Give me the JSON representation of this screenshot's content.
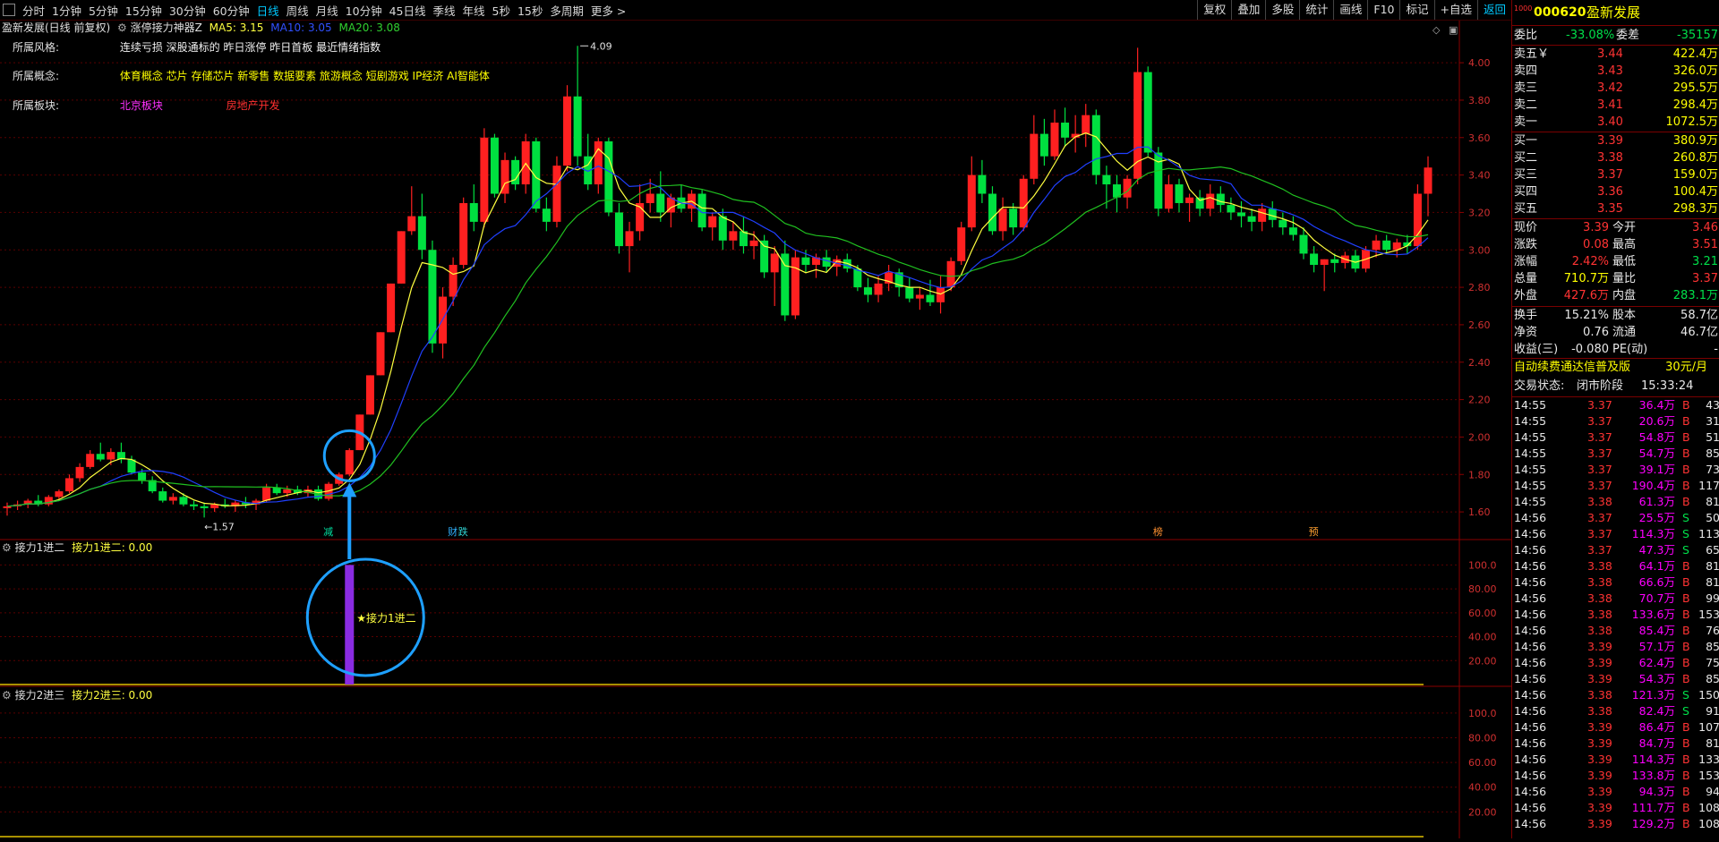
{
  "toolbar": {
    "timeframes": [
      "分时",
      "1分钟",
      "5分钟",
      "15分钟",
      "30分钟",
      "60分钟",
      "日线",
      "周线",
      "月线",
      "10分钟",
      "45日线",
      "季线",
      "年线",
      "5秒",
      "15秒",
      "多周期",
      "更多 >"
    ],
    "active": "日线",
    "right_buttons": [
      "复权",
      "叠加",
      "多股",
      "统计",
      "画线",
      "F10",
      "标记",
      "+自选",
      "返回"
    ]
  },
  "chart_header": {
    "title": "盈新发展(日线 前复权)",
    "indicator": "涨停接力神器Z",
    "ma5": "MA5: 3.15",
    "ma10": "MA10: 3.05",
    "ma20": "MA20: 3.08"
  },
  "info": {
    "style_label": "所属风格:",
    "style_value": "连续亏损 深股通标的 昨日涨停 昨日首板 最近情绪指数",
    "concept_label": "所属概念:",
    "concept_value": "体育概念 芯片 存储芯片 新零售 数据要素 旅游概念 短剧游戏 IP经济 AI智能体",
    "sector_label": "所属板块:",
    "sector_value1": "北京板块",
    "sector_value2": "房地产开发"
  },
  "annotations": {
    "high": "4.09",
    "low": "←1.57",
    "event_jian": "减",
    "event_cai": "财",
    "event_die": "跌",
    "event_bang": "榜",
    "event_yu": "预",
    "event_zhang": "涨",
    "relay_marker": "★接力1进二"
  },
  "price_axis": [
    "4.00",
    "3.80",
    "3.60",
    "3.40",
    "3.20",
    "3.00",
    "2.80",
    "2.60",
    "2.40",
    "2.20",
    "2.00",
    "1.80",
    "1.60"
  ],
  "sub1": {
    "name": "接力1进二",
    "label": "接力1进二: 0.00",
    "axis": [
      "100.0",
      "80.00",
      "60.00",
      "40.00",
      "20.00"
    ]
  },
  "sub2": {
    "name": "接力2进三",
    "label": "接力2进三: 0.00",
    "axis": [
      "100.0",
      "80.00",
      "60.00",
      "40.00",
      "20.00"
    ]
  },
  "colors": {
    "up": "#ff2020",
    "down": "#00e040",
    "ma5": "#ffff40",
    "ma10": "#2040ff",
    "ma20": "#20c020",
    "relay": "#8a2be2",
    "circle": "#1ea0ff"
  },
  "chart_data": {
    "type": "candlestick",
    "ylim": [
      1.5,
      4.12
    ],
    "candles": [
      [
        1.62,
        1.65,
        1.58,
        1.63
      ],
      [
        1.63,
        1.66,
        1.61,
        1.64
      ],
      [
        1.64,
        1.67,
        1.62,
        1.66
      ],
      [
        1.66,
        1.69,
        1.63,
        1.64
      ],
      [
        1.64,
        1.69,
        1.63,
        1.68
      ],
      [
        1.68,
        1.72,
        1.66,
        1.71
      ],
      [
        1.71,
        1.8,
        1.7,
        1.78
      ],
      [
        1.78,
        1.86,
        1.76,
        1.84
      ],
      [
        1.84,
        1.93,
        1.83,
        1.91
      ],
      [
        1.91,
        1.97,
        1.87,
        1.88
      ],
      [
        1.88,
        1.94,
        1.85,
        1.92
      ],
      [
        1.92,
        1.97,
        1.86,
        1.88
      ],
      [
        1.88,
        1.9,
        1.8,
        1.81
      ],
      [
        1.81,
        1.83,
        1.75,
        1.77
      ],
      [
        1.77,
        1.79,
        1.7,
        1.71
      ],
      [
        1.71,
        1.73,
        1.65,
        1.66
      ],
      [
        1.66,
        1.7,
        1.64,
        1.68
      ],
      [
        1.68,
        1.7,
        1.63,
        1.64
      ],
      [
        1.64,
        1.66,
        1.61,
        1.63
      ],
      [
        1.63,
        1.65,
        1.57,
        1.62
      ],
      [
        1.62,
        1.65,
        1.6,
        1.64
      ],
      [
        1.64,
        1.67,
        1.62,
        1.63
      ],
      [
        1.63,
        1.66,
        1.6,
        1.65
      ],
      [
        1.65,
        1.68,
        1.62,
        1.64
      ],
      [
        1.64,
        1.67,
        1.61,
        1.66
      ],
      [
        1.66,
        1.75,
        1.65,
        1.73
      ],
      [
        1.73,
        1.75,
        1.69,
        1.7
      ],
      [
        1.7,
        1.74,
        1.68,
        1.72
      ],
      [
        1.72,
        1.74,
        1.69,
        1.7
      ],
      [
        1.7,
        1.74,
        1.68,
        1.72
      ],
      [
        1.72,
        1.74,
        1.66,
        1.67
      ],
      [
        1.67,
        1.76,
        1.66,
        1.75
      ],
      [
        1.75,
        1.81,
        1.74,
        1.8
      ],
      [
        1.8,
        1.94,
        1.79,
        1.93
      ],
      [
        1.93,
        2.12,
        1.93,
        2.12
      ],
      [
        2.12,
        2.33,
        2.12,
        2.33
      ],
      [
        2.33,
        2.56,
        2.33,
        2.56
      ],
      [
        2.56,
        2.82,
        2.56,
        2.82
      ],
      [
        2.82,
        3.1,
        2.82,
        3.1
      ],
      [
        3.1,
        3.34,
        3.08,
        3.18
      ],
      [
        3.18,
        3.3,
        2.95,
        3.0
      ],
      [
        3.0,
        3.05,
        2.45,
        2.5
      ],
      [
        2.5,
        2.8,
        2.42,
        2.75
      ],
      [
        2.75,
        2.96,
        2.7,
        2.92
      ],
      [
        2.92,
        3.28,
        2.9,
        3.25
      ],
      [
        3.25,
        3.35,
        3.1,
        3.15
      ],
      [
        3.15,
        3.65,
        3.12,
        3.6
      ],
      [
        3.6,
        3.62,
        3.28,
        3.3
      ],
      [
        3.3,
        3.52,
        3.25,
        3.48
      ],
      [
        3.48,
        3.5,
        3.32,
        3.35
      ],
      [
        3.35,
        3.62,
        3.3,
        3.58
      ],
      [
        3.58,
        3.6,
        3.2,
        3.22
      ],
      [
        3.22,
        3.28,
        3.1,
        3.15
      ],
      [
        3.15,
        3.5,
        3.12,
        3.45
      ],
      [
        3.45,
        3.88,
        3.42,
        3.82
      ],
      [
        3.82,
        4.09,
        3.45,
        3.5
      ],
      [
        3.5,
        3.62,
        3.32,
        3.35
      ],
      [
        3.35,
        3.6,
        3.3,
        3.58
      ],
      [
        3.58,
        3.6,
        3.18,
        3.2
      ],
      [
        3.2,
        3.25,
        2.98,
        3.02
      ],
      [
        3.02,
        3.15,
        2.88,
        3.1
      ],
      [
        3.1,
        3.35,
        3.05,
        3.25
      ],
      [
        3.25,
        3.38,
        3.2,
        3.3
      ],
      [
        3.3,
        3.42,
        3.15,
        3.2
      ],
      [
        3.2,
        3.3,
        3.12,
        3.28
      ],
      [
        3.28,
        3.35,
        3.2,
        3.22
      ],
      [
        3.22,
        3.32,
        3.15,
        3.3
      ],
      [
        3.3,
        3.32,
        3.1,
        3.12
      ],
      [
        3.12,
        3.2,
        3.05,
        3.18
      ],
      [
        3.18,
        3.22,
        3.0,
        3.05
      ],
      [
        3.05,
        3.15,
        3.0,
        3.1
      ],
      [
        3.1,
        3.18,
        2.98,
        3.02
      ],
      [
        3.02,
        3.1,
        2.95,
        3.05
      ],
      [
        3.05,
        3.08,
        2.85,
        2.88
      ],
      [
        2.88,
        3.02,
        2.7,
        2.98
      ],
      [
        2.98,
        3.05,
        2.62,
        2.65
      ],
      [
        2.65,
        3.0,
        2.63,
        2.96
      ],
      [
        2.96,
        3.0,
        2.88,
        2.92
      ],
      [
        2.92,
        2.98,
        2.85,
        2.96
      ],
      [
        2.96,
        3.0,
        2.88,
        2.91
      ],
      [
        2.91,
        2.97,
        2.86,
        2.95
      ],
      [
        2.95,
        2.98,
        2.88,
        2.9
      ],
      [
        2.9,
        2.92,
        2.78,
        2.8
      ],
      [
        2.8,
        2.85,
        2.72,
        2.76
      ],
      [
        2.76,
        2.86,
        2.72,
        2.82
      ],
      [
        2.82,
        2.92,
        2.78,
        2.88
      ],
      [
        2.88,
        2.9,
        2.75,
        2.8
      ],
      [
        2.8,
        2.85,
        2.72,
        2.74
      ],
      [
        2.74,
        2.8,
        2.68,
        2.76
      ],
      [
        2.76,
        2.84,
        2.7,
        2.72
      ],
      [
        2.72,
        2.86,
        2.66,
        2.8
      ],
      [
        2.8,
        2.96,
        2.78,
        2.94
      ],
      [
        2.94,
        3.15,
        2.92,
        3.12
      ],
      [
        3.12,
        3.5,
        3.1,
        3.4
      ],
      [
        3.4,
        3.48,
        3.25,
        3.3
      ],
      [
        3.3,
        3.34,
        3.08,
        3.1
      ],
      [
        3.1,
        3.28,
        3.05,
        3.22
      ],
      [
        3.22,
        3.25,
        3.08,
        3.12
      ],
      [
        3.12,
        3.4,
        3.1,
        3.38
      ],
      [
        3.38,
        3.72,
        3.35,
        3.62
      ],
      [
        3.62,
        3.7,
        3.45,
        3.5
      ],
      [
        3.5,
        3.75,
        3.48,
        3.68
      ],
      [
        3.68,
        3.76,
        3.55,
        3.6
      ],
      [
        3.6,
        3.72,
        3.52,
        3.62
      ],
      [
        3.62,
        3.78,
        3.55,
        3.72
      ],
      [
        3.72,
        3.75,
        3.35,
        3.4
      ],
      [
        3.4,
        3.45,
        3.22,
        3.35
      ],
      [
        3.35,
        3.4,
        3.2,
        3.28
      ],
      [
        3.28,
        3.4,
        3.22,
        3.38
      ],
      [
        3.38,
        4.08,
        3.35,
        3.95
      ],
      [
        3.95,
        3.98,
        3.5,
        3.52
      ],
      [
        3.52,
        3.55,
        3.18,
        3.22
      ],
      [
        3.22,
        3.4,
        3.2,
        3.35
      ],
      [
        3.35,
        3.38,
        3.2,
        3.25
      ],
      [
        3.25,
        3.3,
        3.15,
        3.28
      ],
      [
        3.28,
        3.32,
        3.18,
        3.22
      ],
      [
        3.22,
        3.35,
        3.18,
        3.3
      ],
      [
        3.3,
        3.34,
        3.2,
        3.24
      ],
      [
        3.24,
        3.28,
        3.16,
        3.2
      ],
      [
        3.2,
        3.26,
        3.12,
        3.18
      ],
      [
        3.18,
        3.22,
        3.1,
        3.15
      ],
      [
        3.15,
        3.25,
        3.1,
        3.22
      ],
      [
        3.22,
        3.26,
        3.12,
        3.16
      ],
      [
        3.16,
        3.2,
        3.08,
        3.12
      ],
      [
        3.12,
        3.18,
        3.05,
        3.08
      ],
      [
        3.08,
        3.12,
        2.95,
        2.98
      ],
      [
        2.98,
        3.02,
        2.88,
        2.92
      ],
      [
        2.92,
        2.95,
        2.78,
        2.95
      ],
      [
        2.95,
        2.98,
        2.88,
        2.93
      ],
      [
        2.93,
        2.99,
        2.9,
        2.97
      ],
      [
        2.97,
        3.0,
        2.88,
        2.9
      ],
      [
        2.9,
        3.02,
        2.88,
        3.0
      ],
      [
        3.0,
        3.08,
        2.96,
        3.05
      ],
      [
        3.05,
        3.08,
        2.98,
        3.0
      ],
      [
        3.0,
        3.06,
        2.96,
        3.04
      ],
      [
        3.04,
        3.08,
        2.98,
        3.02
      ],
      [
        3.02,
        3.35,
        3.0,
        3.3
      ],
      [
        3.3,
        3.5,
        3.18,
        3.44
      ]
    ],
    "relay_bar_index": 33,
    "relay_value": 100
  },
  "quote": {
    "code": "000620",
    "name": "盈新发展",
    "weibi_label": "委比",
    "weibi": "-33.08%",
    "weicha_label": "委差",
    "weicha": "-35157",
    "sells": [
      {
        "label": "卖五￥",
        "price": "3.44",
        "vol": "422.4万"
      },
      {
        "label": "卖四",
        "price": "3.43",
        "vol": "326.0万"
      },
      {
        "label": "卖三",
        "price": "3.42",
        "vol": "295.5万"
      },
      {
        "label": "卖二",
        "price": "3.41",
        "vol": "298.4万"
      },
      {
        "label": "卖一",
        "price": "3.40",
        "vol": "1072.5万"
      }
    ],
    "buys": [
      {
        "label": "买一",
        "price": "3.39",
        "vol": "380.9万"
      },
      {
        "label": "买二",
        "price": "3.38",
        "vol": "260.8万"
      },
      {
        "label": "买三",
        "price": "3.37",
        "vol": "159.0万"
      },
      {
        "label": "买四",
        "price": "3.36",
        "vol": "100.4万"
      },
      {
        "label": "买五",
        "price": "3.35",
        "vol": "298.3万"
      }
    ],
    "stats": [
      {
        "l1": "现价",
        "v1": "3.39",
        "c1": "red",
        "l2": "今开",
        "v2": "3.46",
        "c2": "red"
      },
      {
        "l1": "涨跌",
        "v1": "0.08",
        "c1": "red",
        "l2": "最高",
        "v2": "3.51",
        "c2": "red"
      },
      {
        "l1": "涨幅",
        "v1": "2.42%",
        "c1": "red",
        "l2": "最低",
        "v2": "3.21",
        "c2": "green"
      },
      {
        "l1": "总量",
        "v1": "710.7万",
        "c1": "yellow",
        "l2": "量比",
        "v2": "3.37",
        "c2": "red"
      },
      {
        "l1": "外盘",
        "v1": "427.6万",
        "c1": "red",
        "l2": "内盘",
        "v2": "283.1万",
        "c2": "green"
      }
    ],
    "stats2": [
      {
        "l1": "换手",
        "v1": "15.21%",
        "l2": "股本",
        "v2": "58.7亿"
      },
      {
        "l1": "净资",
        "v1": "0.76",
        "l2": "流通",
        "v2": "46.7亿"
      },
      {
        "l1": "收益(三)",
        "v1": "-0.080",
        "l2": "PE(动)",
        "v2": "-"
      }
    ],
    "ad_text": "自动续费通达信普及版",
    "ad_price": "30元/月",
    "trade_status_label": "交易状态:",
    "trade_status": "闭市阶段",
    "trade_time": "15:33:24",
    "ticks": [
      [
        "14:55",
        "3.37",
        "36.4万",
        "B",
        "43"
      ],
      [
        "14:55",
        "3.37",
        "20.6万",
        "B",
        "31"
      ],
      [
        "14:55",
        "3.37",
        "54.8万",
        "B",
        "51"
      ],
      [
        "14:55",
        "3.37",
        "54.7万",
        "B",
        "85"
      ],
      [
        "14:55",
        "3.37",
        "39.1万",
        "B",
        "73"
      ],
      [
        "14:55",
        "3.37",
        "190.4万",
        "B",
        "117"
      ],
      [
        "14:55",
        "3.38",
        "61.3万",
        "B",
        "81"
      ],
      [
        "14:56",
        "3.37",
        "25.5万",
        "S",
        "50"
      ],
      [
        "14:56",
        "3.37",
        "114.3万",
        "S",
        "113"
      ],
      [
        "14:56",
        "3.37",
        "47.3万",
        "S",
        "65"
      ],
      [
        "14:56",
        "3.38",
        "64.1万",
        "B",
        "81"
      ],
      [
        "14:56",
        "3.38",
        "66.6万",
        "B",
        "81"
      ],
      [
        "14:56",
        "3.38",
        "70.7万",
        "B",
        "99"
      ],
      [
        "14:56",
        "3.38",
        "133.6万",
        "B",
        "153"
      ],
      [
        "14:56",
        "3.38",
        "85.4万",
        "B",
        "76"
      ],
      [
        "14:56",
        "3.39",
        "57.1万",
        "B",
        "85"
      ],
      [
        "14:56",
        "3.39",
        "62.4万",
        "B",
        "75"
      ],
      [
        "14:56",
        "3.39",
        "54.3万",
        "B",
        "85"
      ],
      [
        "14:56",
        "3.38",
        "121.3万",
        "S",
        "150"
      ],
      [
        "14:56",
        "3.38",
        "82.4万",
        "S",
        "91"
      ],
      [
        "14:56",
        "3.39",
        "86.4万",
        "B",
        "107"
      ],
      [
        "14:56",
        "3.39",
        "84.7万",
        "B",
        "81"
      ],
      [
        "14:56",
        "3.39",
        "114.3万",
        "B",
        "133"
      ],
      [
        "14:56",
        "3.39",
        "133.8万",
        "B",
        "153"
      ],
      [
        "14:56",
        "3.39",
        "94.3万",
        "B",
        "94"
      ],
      [
        "14:56",
        "3.39",
        "111.7万",
        "B",
        "108"
      ],
      [
        "14:56",
        "3.39",
        "129.2万",
        "B",
        "108"
      ]
    ]
  }
}
